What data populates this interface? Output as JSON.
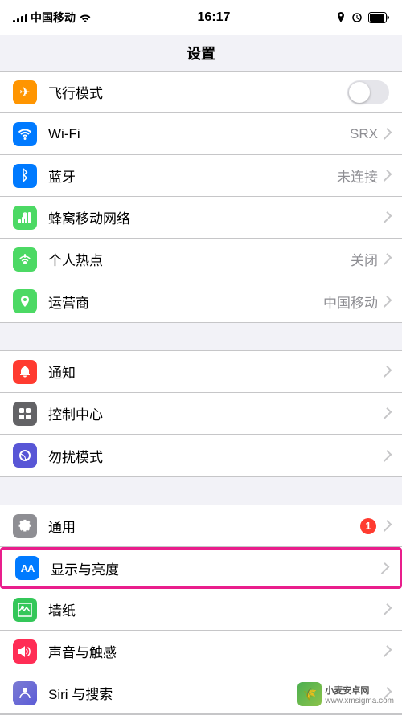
{
  "statusBar": {
    "carrier": "中国移动",
    "wifi_icon": "wifi",
    "time": "16:17",
    "icons_right": [
      "location",
      "alarm",
      "battery"
    ],
    "battery_level": "100"
  },
  "pageTitle": "设置",
  "sections": [
    {
      "id": "network",
      "rows": [
        {
          "id": "airplane",
          "icon": "airplane",
          "icon_color": "icon-airplane",
          "icon_char": "✈",
          "label": "飞行模式",
          "value": "",
          "has_toggle": true,
          "toggle_on": false,
          "has_chevron": false
        },
        {
          "id": "wifi",
          "icon": "wifi",
          "icon_color": "icon-wifi",
          "icon_char": "📶",
          "label": "Wi-Fi",
          "value": "SRX",
          "has_chevron": true
        },
        {
          "id": "bluetooth",
          "icon": "bluetooth",
          "icon_color": "icon-bluetooth",
          "icon_char": "◈",
          "label": "蓝牙",
          "value": "未连接",
          "has_chevron": true
        },
        {
          "id": "cellular",
          "icon": "cellular",
          "icon_color": "icon-cellular",
          "icon_char": "((·))",
          "label": "蜂窝移动网络",
          "value": "",
          "has_chevron": true
        },
        {
          "id": "hotspot",
          "icon": "hotspot",
          "icon_color": "icon-hotspot",
          "icon_char": "⊙",
          "label": "个人热点",
          "value": "关闭",
          "has_chevron": true
        },
        {
          "id": "carrier",
          "icon": "carrier",
          "icon_color": "icon-carrier",
          "icon_char": "📞",
          "label": "运营商",
          "value": "中国移动",
          "has_chevron": true
        }
      ]
    },
    {
      "id": "system",
      "rows": [
        {
          "id": "notification",
          "icon": "notification",
          "icon_color": "icon-notification",
          "icon_char": "🔔",
          "label": "通知",
          "value": "",
          "has_chevron": true
        },
        {
          "id": "control",
          "icon": "control",
          "icon_color": "icon-control",
          "icon_char": "⊞",
          "label": "控制中心",
          "value": "",
          "has_chevron": true
        },
        {
          "id": "dnd",
          "icon": "dnd",
          "icon_color": "icon-dnd",
          "icon_char": "🌙",
          "label": "勿扰模式",
          "value": "",
          "has_chevron": true
        }
      ]
    },
    {
      "id": "display_group",
      "rows": [
        {
          "id": "general",
          "icon": "general",
          "icon_color": "icon-general",
          "icon_char": "⚙",
          "label": "通用",
          "value": "",
          "badge": "1",
          "has_chevron": true,
          "highlighted": false
        },
        {
          "id": "display",
          "icon": "display",
          "icon_color": "icon-display",
          "icon_char": "AA",
          "label": "显示与亮度",
          "value": "",
          "has_chevron": true,
          "highlighted": true
        },
        {
          "id": "wallpaper",
          "icon": "wallpaper",
          "icon_color": "icon-wallpaper",
          "icon_char": "❋",
          "label": "墙纸",
          "value": "",
          "has_chevron": true
        },
        {
          "id": "sounds",
          "icon": "sounds",
          "icon_color": "icon-sounds",
          "icon_char": "🔊",
          "label": "声音与触感",
          "value": "",
          "has_chevron": true
        },
        {
          "id": "siri",
          "icon": "siri",
          "icon_color": "icon-siri",
          "icon_char": "◉",
          "label": "Siri 与搜索",
          "value": "",
          "has_chevron": true
        }
      ]
    }
  ],
  "watermark": {
    "site": "www.xmsigma.com",
    "text": "小麦安卓网"
  }
}
